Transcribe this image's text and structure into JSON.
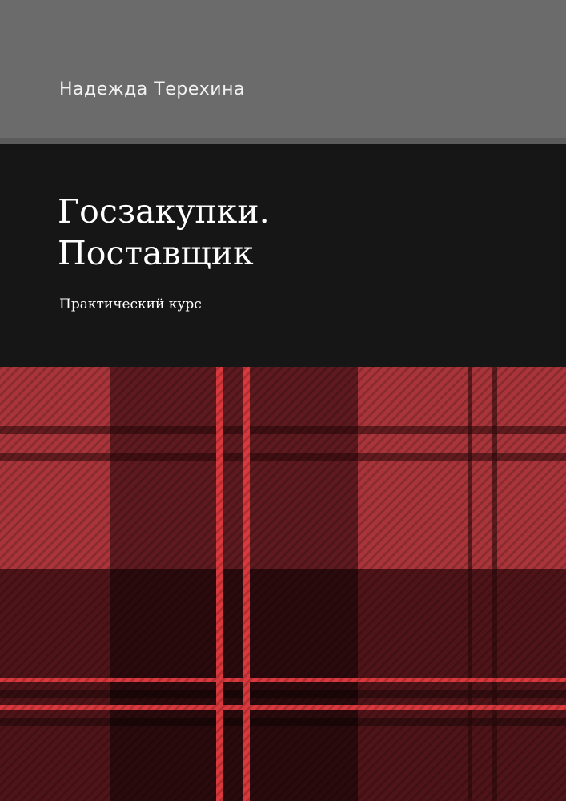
{
  "cover": {
    "author": "Надежда Терехина",
    "title_line1": "Госзакупки.",
    "title_line2": "Поставщик",
    "subtitle": "Практический курс"
  },
  "colors": {
    "author_band": "#6b6b6b",
    "title_band": "#161616",
    "tartan_light": "#a9353b",
    "tartan_mid": "#5e1a1e",
    "tartan_dark": "#2a0a0c",
    "tartan_stripe": "#d9383d"
  },
  "decoration": {
    "pattern": "red tartan plaid"
  }
}
